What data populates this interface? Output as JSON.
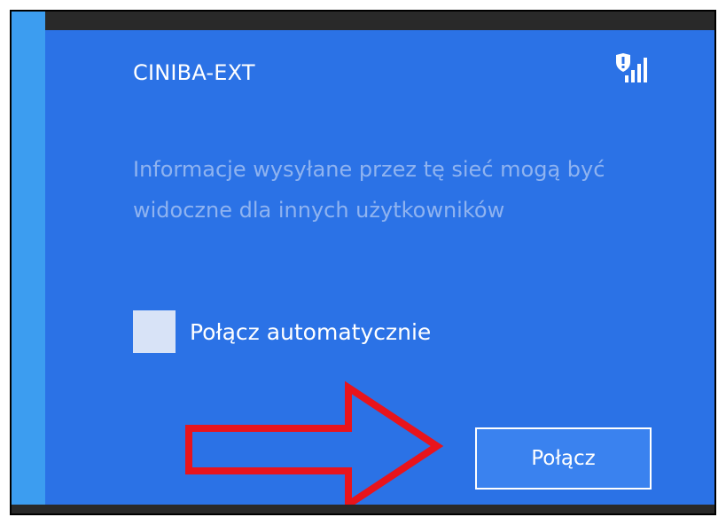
{
  "network": {
    "name": "CINIBA-EXT",
    "status_icon": "wifi-signal-warning-icon"
  },
  "message": {
    "text": "Informacje wysyłane przez tę sieć mogą być widoczne dla innych użytkowników"
  },
  "auto_connect": {
    "label": "Połącz automatycznie",
    "checked": false
  },
  "connect_button": {
    "label": "Połącz"
  },
  "annotation": {
    "icon": "red-arrow-icon",
    "color": "#e8141c"
  },
  "colors": {
    "panel": "#2b72e6",
    "accent_strip": "#3c9df0",
    "frame_dark": "#292929"
  }
}
